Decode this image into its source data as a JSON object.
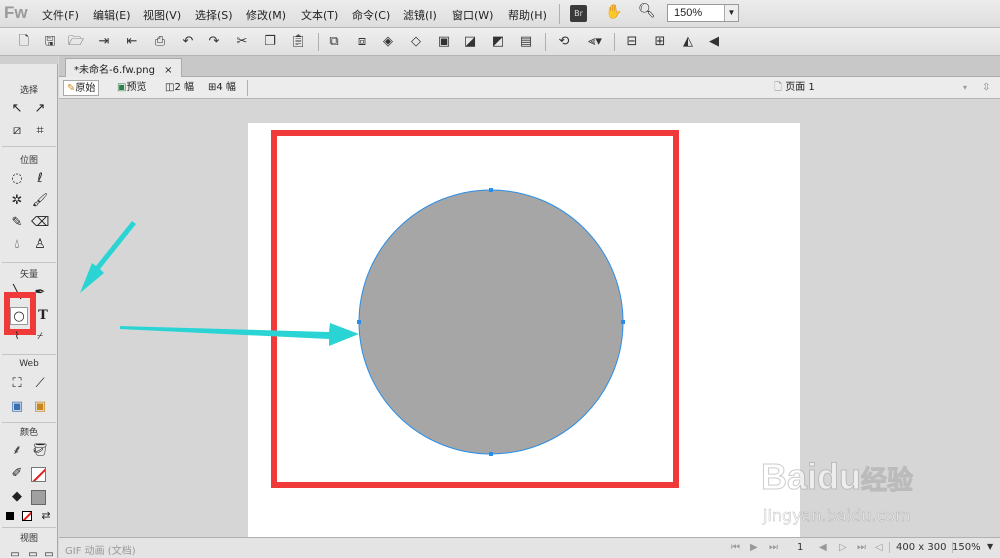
{
  "app": {
    "logo": "Fw"
  },
  "menu": [
    "文件(F)",
    "编辑(E)",
    "视图(V)",
    "选择(S)",
    "修改(M)",
    "文本(T)",
    "命令(C)",
    "滤镜(I)",
    "窗口(W)",
    "帮助(H)"
  ],
  "topbar": {
    "bridge_label": "Br",
    "zoom_value": "150%"
  },
  "document": {
    "tab_label": "*未命名-6.fw.png",
    "close_glyph": "×"
  },
  "viewbar": {
    "original": "原始",
    "preview": "预览",
    "two_up": "2 幅",
    "four_up": "4 幅",
    "page": "页面 1"
  },
  "tools_panel": {
    "sections": [
      "选择",
      "位图",
      "矢量",
      "Web",
      "颜色",
      "视图"
    ]
  },
  "statusbar": {
    "format": "GIF 动画 (文档)",
    "frame": "1",
    "doc_size": "400 x 300",
    "zoom": "150%"
  },
  "watermark": {
    "brand": "Baidu",
    "brand_cn": "经验",
    "url": "jingyan.baidu.com"
  },
  "colors": {
    "highlight_red": "#f03a3a",
    "arrow_cyan": "#2ad4d4",
    "circle_fill": "#a6a6a6",
    "selection_blue": "#2a8ee8"
  },
  "icons": [
    "new-icon",
    "open-icon",
    "save-icon",
    "import-icon",
    "export-icon",
    "print-icon",
    "undo-icon",
    "redo-icon",
    "cut-icon",
    "copy-icon",
    "paste-icon",
    "group-icon",
    "ungroup-icon",
    "join-icon",
    "split-icon",
    "bring-front-icon",
    "bring-forward-icon",
    "send-backward-icon",
    "send-back-icon",
    "align-icon",
    "rotate-icon",
    "flip-horizontal-icon",
    "flip-vertical-icon"
  ]
}
